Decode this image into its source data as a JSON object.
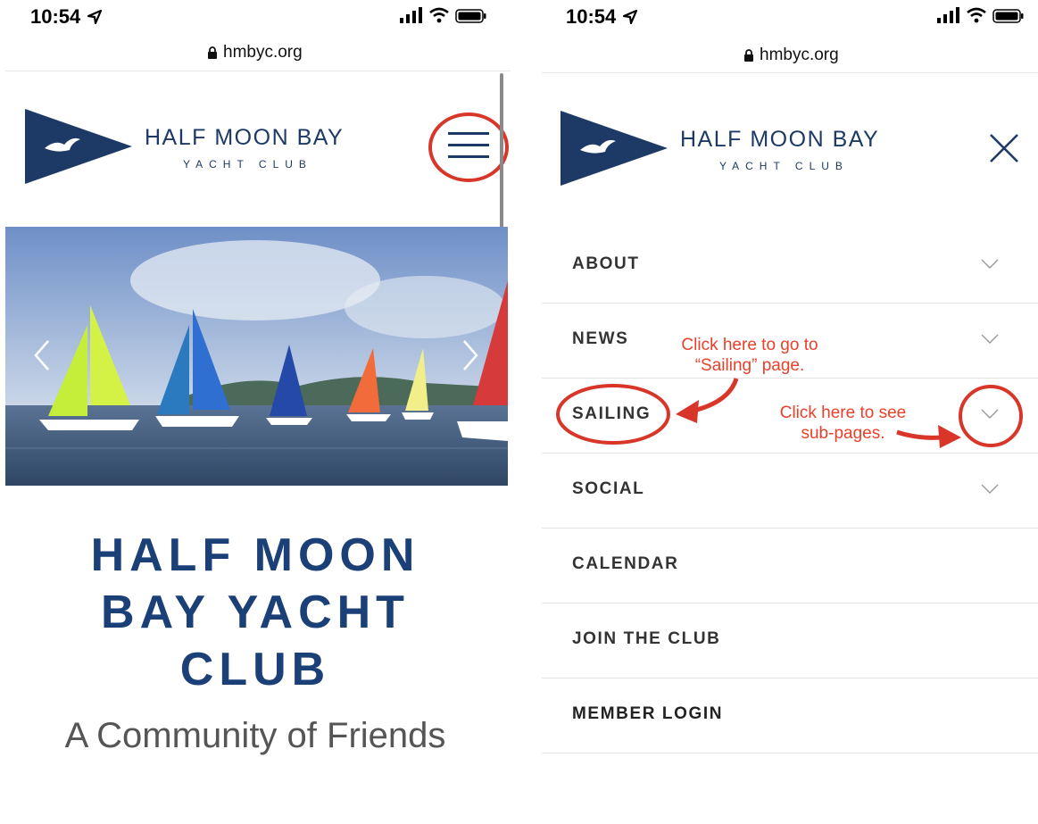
{
  "left": {
    "status": {
      "time": "10:54"
    },
    "url": "hmbyc.org",
    "brand": {
      "title": "HALF MOON BAY",
      "subtitle": "YACHT CLUB"
    },
    "hero": {
      "title_lines": [
        "HALF MOON",
        "BAY YACHT",
        "CLUB"
      ],
      "tagline": "A Community of Friends"
    }
  },
  "right": {
    "status": {
      "time": "10:54"
    },
    "url": "hmbyc.org",
    "brand": {
      "title": "HALF MOON BAY",
      "subtitle": "YACHT CLUB"
    },
    "menu": [
      {
        "label": "ABOUT"
      },
      {
        "label": "NEWS"
      },
      {
        "label": "SAILING"
      },
      {
        "label": "SOCIAL"
      },
      {
        "label": "CALENDAR"
      },
      {
        "label": "JOIN THE CLUB"
      },
      {
        "label": "MEMBER LOGIN"
      }
    ],
    "annotations": {
      "sailing_page": "Click here to go to “Sailing” page.",
      "subpages": "Click here to see sub-pages."
    }
  },
  "colors": {
    "navy": "#1d3a66",
    "annotation_red": "#d9362a",
    "flag_orange": "#e9873a"
  }
}
